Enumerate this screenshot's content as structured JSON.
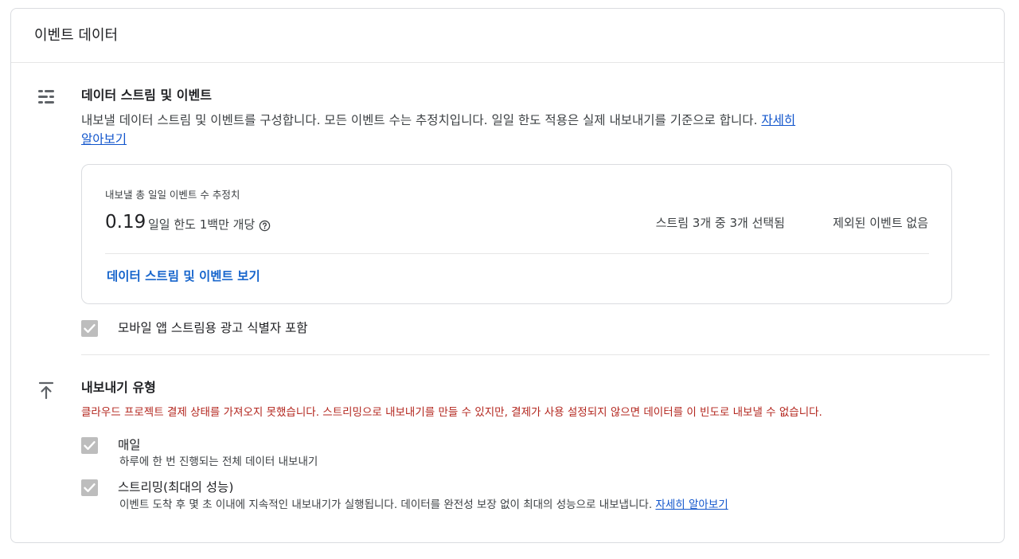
{
  "card": {
    "title": "이벤트 데이터"
  },
  "streams_section": {
    "icon": "data-streams-icon",
    "title": "데이터 스트림 및 이벤트",
    "description": "내보낼 데이터 스트림 및 이벤트를 구성합니다. 모든 이벤트 수는 추정치입니다. 일일 한도 적용은 실제 내보내기를 기준으로 합니다.",
    "learn_more_1": "자세히",
    "learn_more_2": "알아보기",
    "estimate": {
      "label": "내보낼 총 일일 이벤트 수 추정치",
      "value": "0.19",
      "limit": "일일 한도 1백만 개당",
      "help_icon": "help-circle-icon",
      "streams_selected": "스트림 3개 중 3개 선택됨",
      "excluded_events": "제외된 이벤트 없음",
      "view_link": "데이터 스트림 및 이벤트 보기"
    },
    "ad_identifier_checkbox": {
      "label": "모바일 앱 스트림용 광고 식별자 포함",
      "checked": true
    }
  },
  "export_section": {
    "icon": "upload-icon",
    "title": "내보내기 유형",
    "error": "클라우드 프로젝트 결제 상태를 가져오지 못했습니다. 스트리밍으로 내보내기를 만들 수 있지만, 결제가 사용 설정되지 않으면 데이터를 이 빈도로 내보낼 수 없습니다.",
    "daily": {
      "label": "매일",
      "sub": "하루에 한 번 진행되는 전체 데이터 내보내기",
      "checked": true
    },
    "streaming": {
      "label": "스트리밍(최대의 성능)",
      "sub": "이벤트 도착 후 몇 초 이내에 지속적인 내보내기가 실행됩니다. 데이터를 완전성 보장 없이 최대의 성능으로 내보냅니다.",
      "learn_more": "자세히 알아보기",
      "checked": true
    }
  },
  "colors": {
    "link": "#1155cc",
    "error": "#b3261e",
    "checkbox_disabled": "#bdbdbd"
  }
}
